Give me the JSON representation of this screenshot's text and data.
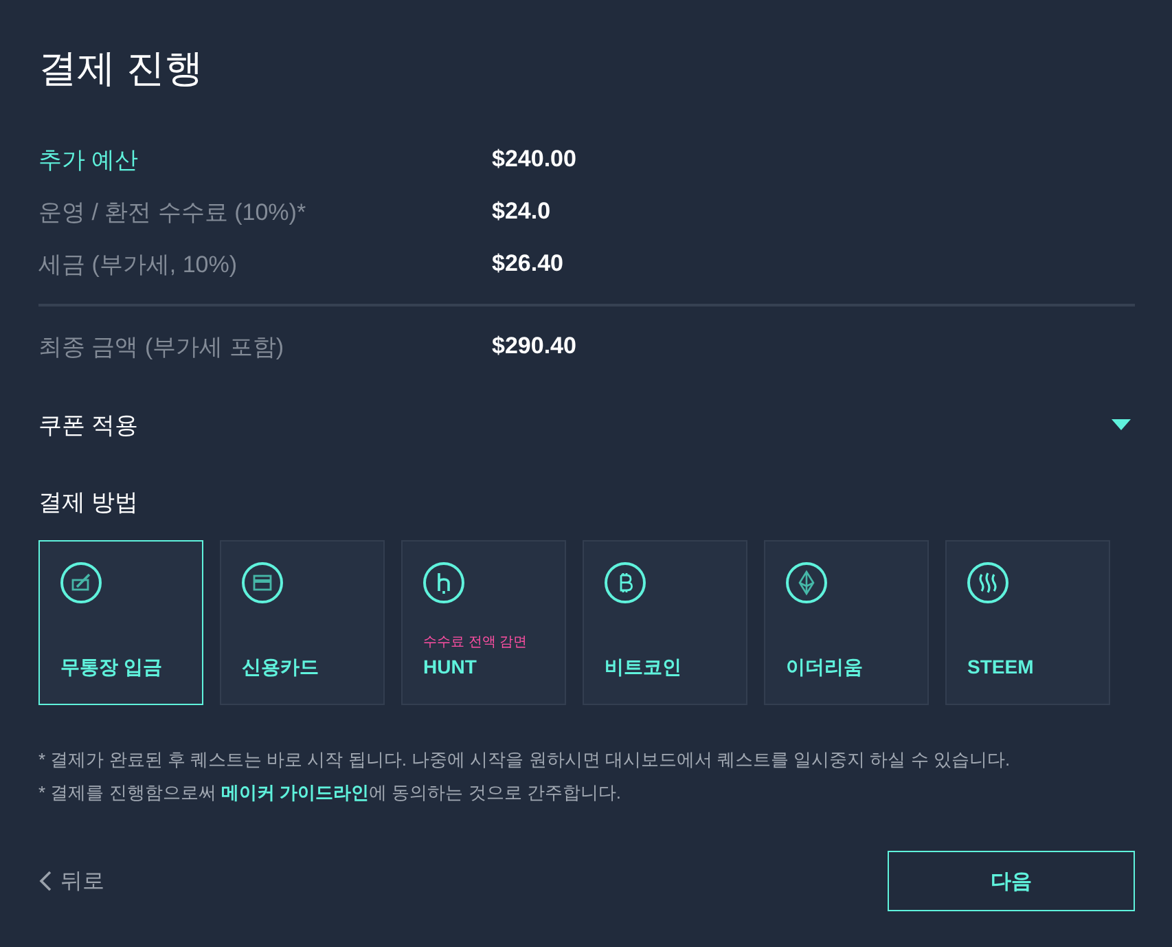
{
  "title": "결제 진행",
  "summary": [
    {
      "label": "추가 예산",
      "value": "$240.00",
      "highlighted": true
    },
    {
      "label": "운영 / 환전 수수료 (10%)*",
      "value": "$24.0",
      "highlighted": false
    },
    {
      "label": "세금 (부가세, 10%)",
      "value": "$26.40",
      "highlighted": false
    }
  ],
  "total": {
    "label": "최종 금액 (부가세 포함)",
    "value": "$290.40"
  },
  "coupon": {
    "label": "쿠폰 적용",
    "expanded": false
  },
  "payment": {
    "heading": "결제 방법",
    "methods": [
      {
        "kind": "bank",
        "label": "무통장 입금",
        "selected": true
      },
      {
        "kind": "card",
        "label": "신용카드",
        "selected": false
      },
      {
        "kind": "hunt",
        "label": "HUNT",
        "note": "수수료 전액 감면",
        "selected": false
      },
      {
        "kind": "bitcoin",
        "label": "비트코인",
        "selected": false
      },
      {
        "kind": "ethereum",
        "label": "이더리움",
        "selected": false
      },
      {
        "kind": "steem",
        "label": "STEEM",
        "selected": false
      }
    ]
  },
  "notes": [
    {
      "text": "* 결제가 완료된 후 퀘스트는 바로 시작 됩니다. 나중에 시작을 원하시면 대시보드에서 퀘스트를 일시중지 하실 수 있습니다."
    },
    {
      "text": "* 결제를 진행함으로써 ",
      "link": "메이커 가이드라인",
      "after": "에 동의하는 것으로 간주합니다."
    }
  ],
  "footer": {
    "back": "뒤로",
    "next": "다음"
  }
}
